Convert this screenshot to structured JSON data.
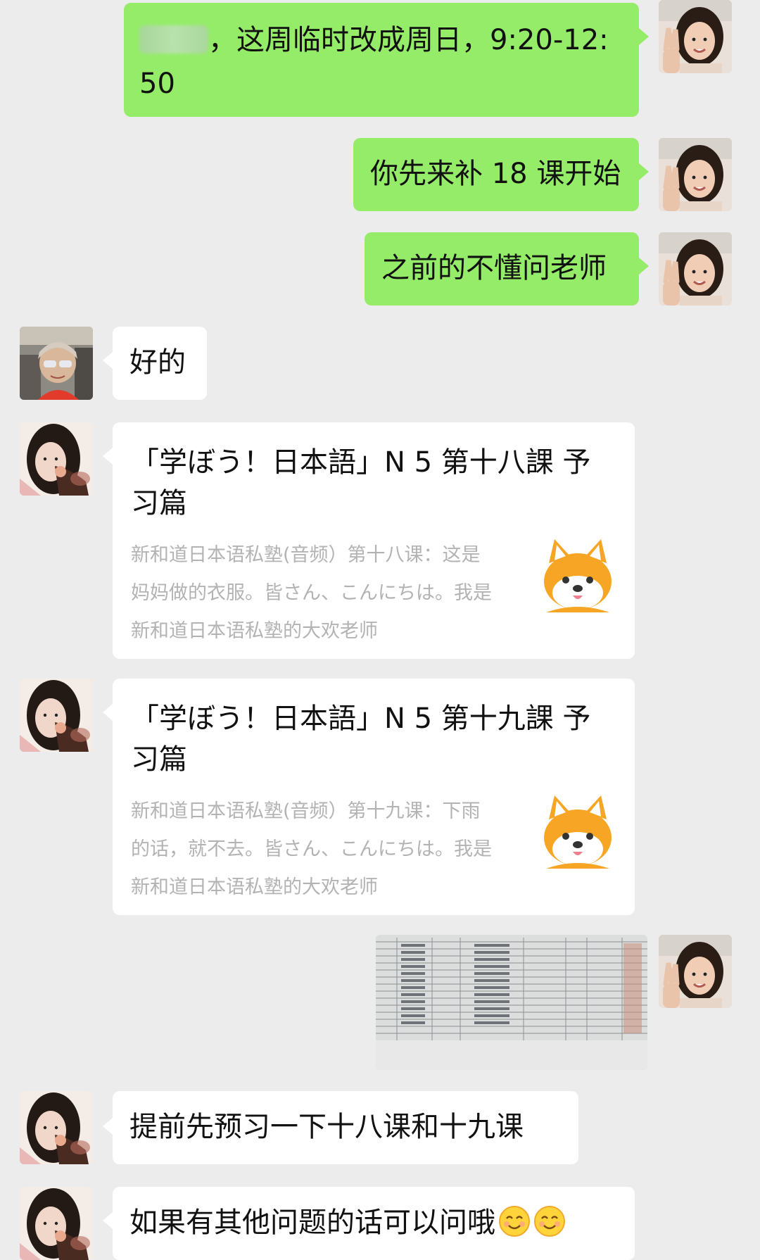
{
  "messages": [
    {
      "side": "out",
      "avatar": "me",
      "text_prefix": "，这周临时改成周日，9:20-12:",
      "text_line2": "50"
    },
    {
      "side": "out",
      "avatar": "me",
      "text": "你先来补 18 课开始"
    },
    {
      "side": "out",
      "avatar": "me",
      "text": "之前的不懂问老师"
    },
    {
      "side": "in",
      "avatar": "student",
      "text": "好的"
    },
    {
      "side": "in",
      "avatar": "teacher",
      "type": "card",
      "title": "「学ぼう！日本語」N 5 第十八課 予习篇",
      "desc": "新和道日本语私塾(音频）第十八课：这是妈妈做的衣服。皆さん、こんにちは。我是新和道日本语私塾的大欢老师",
      "thumb": "shiba-dog-icon"
    },
    {
      "side": "in",
      "avatar": "teacher",
      "type": "card",
      "title": "「学ぼう！日本語」N 5 第十九課 予习篇",
      "desc": "新和道日本语私塾(音频）第十九课：下雨的话，就不去。皆さん、こんにちは。我是新和道日本语私塾的大欢老师",
      "thumb": "shiba-dog-icon"
    },
    {
      "side": "out",
      "avatar": "me",
      "type": "image",
      "image": "schedule-table-photo"
    },
    {
      "side": "in",
      "avatar": "teacher",
      "text": "提前先预习一下十八课和十九课"
    },
    {
      "side": "in",
      "avatar": "teacher",
      "text": "如果有其他问题的话可以问哦",
      "emoji": [
        "smile-emoji",
        "smile-emoji"
      ]
    }
  ],
  "colors": {
    "background": "#ececec",
    "outgoing": "#95ec69",
    "incoming": "#ffffff"
  }
}
